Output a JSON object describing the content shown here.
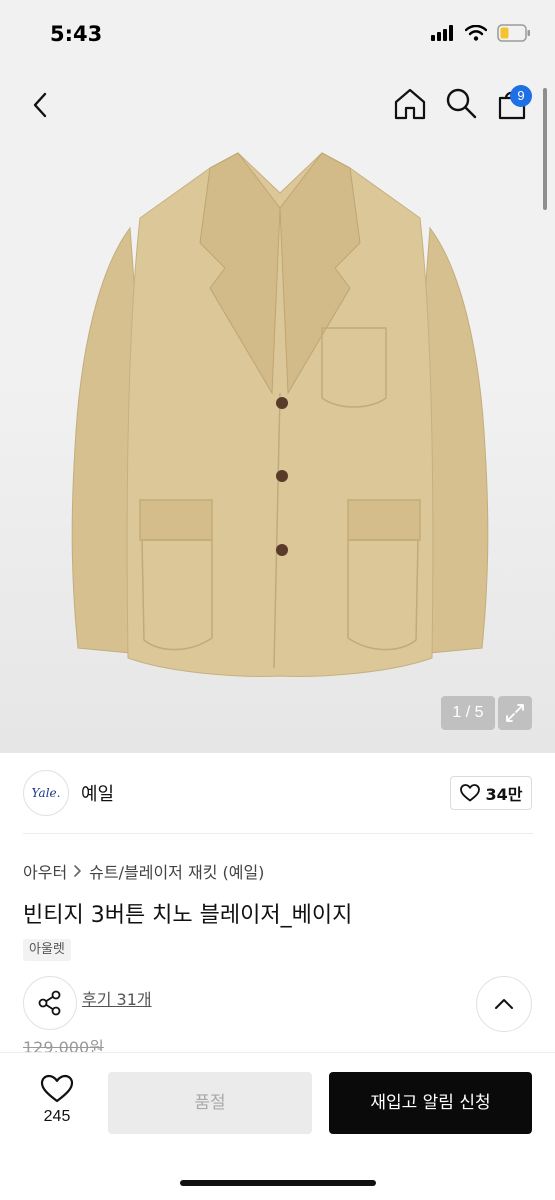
{
  "status_bar": {
    "time": "5:43"
  },
  "nav": {
    "cart_count": "9"
  },
  "gallery": {
    "counter": "1 / 5"
  },
  "brand": {
    "logo_text": "Yale.",
    "name": "예일",
    "likes": "34만"
  },
  "product": {
    "breadcrumb": [
      "아우터",
      "슈트/블레이저 재킷 (예일)"
    ],
    "title": "빈티지 3버튼 치노 블레이저_베이지",
    "tag": "아울렛",
    "reviews": "후기 31개",
    "original_price": "129,000원"
  },
  "bottom_bar": {
    "wish_count": "245",
    "soldout_label": "품절",
    "restock_label": "재입고 알림 신청"
  },
  "colors": {
    "accent_blue": "#1f6fe5",
    "jacket_beige": "#d8c394",
    "button_black": "#0a0a0a"
  }
}
